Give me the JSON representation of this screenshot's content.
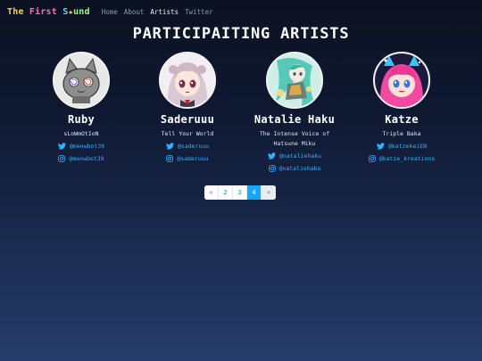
{
  "site": {
    "brand_parts": [
      "The ",
      "First ",
      "S",
      "und"
    ],
    "brand_star": "★",
    "nav": [
      "Home",
      "About",
      "Artists",
      "Twitter"
    ],
    "active_nav": "Artists"
  },
  "page_title": "PARTICIPAITING ARTISTS",
  "artists": [
    {
      "name": "Ruby",
      "tagline": "sLoWmOtIoN",
      "socials": [
        {
          "type": "twitter",
          "handle": "@meowbot39"
        },
        {
          "type": "instagram",
          "handle": "@meowbot39"
        }
      ]
    },
    {
      "name": "Saderuuu",
      "tagline": "Tell Your World",
      "socials": [
        {
          "type": "twitter",
          "handle": "@saderuuu"
        },
        {
          "type": "instagram",
          "handle": "@saderuuu"
        }
      ]
    },
    {
      "name": "Natalie Haku",
      "tagline": "The Intense Voice of Hatsune Miku",
      "socials": [
        {
          "type": "twitter",
          "handle": "@nataliehaku"
        },
        {
          "type": "instagram",
          "handle": "@nataliehaku"
        }
      ]
    },
    {
      "name": "Katze",
      "tagline": "Triple Baka",
      "socials": [
        {
          "type": "twitter",
          "handle": "@katzekeiEN"
        },
        {
          "type": "instagram",
          "handle": "@katze_kreations"
        }
      ]
    }
  ],
  "pagination": {
    "prev": "«",
    "pages": [
      "2",
      "3",
      "4"
    ],
    "current": "4",
    "next": "»"
  },
  "colors": {
    "accent": "#2fb3ff",
    "page_current": "#13a7ff",
    "background_top": "#0b1222",
    "background_bottom": "#263d6b"
  },
  "icons": {
    "twitter": "twitter-bird-icon",
    "instagram": "instagram-camera-icon"
  }
}
